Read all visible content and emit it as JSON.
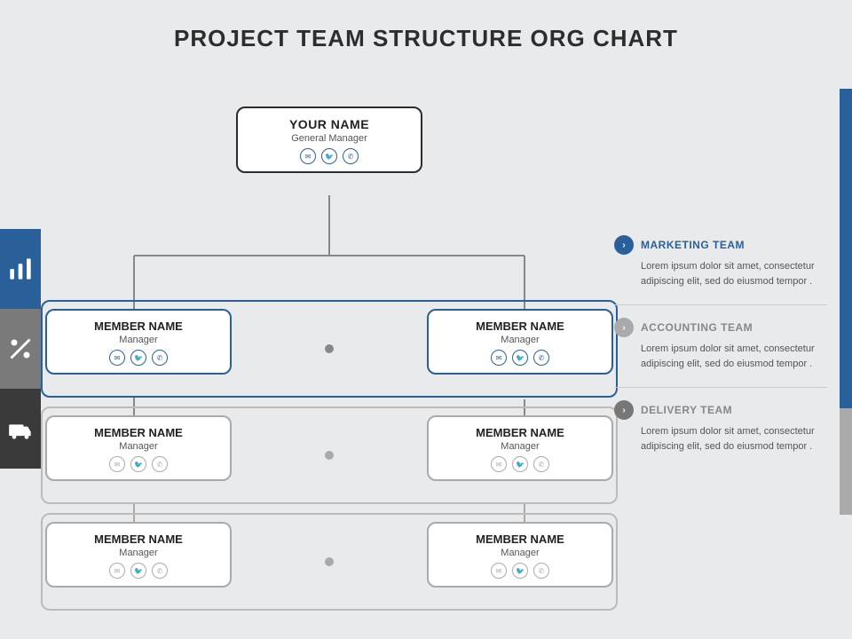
{
  "title": "PROJECT TEAM STRUCTURE ORG CHART",
  "top_node": {
    "name": "YOUR NAME",
    "role": "General Manager"
  },
  "sidebar": {
    "tabs": [
      {
        "icon": "chart-icon",
        "active": true
      },
      {
        "icon": "percent-icon",
        "active": false
      },
      {
        "icon": "truck-icon",
        "active": false
      }
    ]
  },
  "rows": [
    {
      "band_color": "blue",
      "left": {
        "name": "MEMBER NAME",
        "role": "Manager"
      },
      "right": {
        "name": "MEMBER NAME",
        "role": "Manager"
      }
    },
    {
      "band_color": "gray",
      "left": {
        "name": "MEMBER NAME",
        "role": "Manager"
      },
      "right": {
        "name": "MEMBER NAME",
        "role": "Manager"
      }
    },
    {
      "band_color": "gray",
      "left": {
        "name": "MEMBER NAME",
        "role": "Manager"
      },
      "right": {
        "name": "MEMBER NAME",
        "role": "Manager"
      }
    }
  ],
  "info_panel": [
    {
      "team": "MARKETING TEAM",
      "team_color": "blue",
      "chevron_color": "blue",
      "text": "Lorem ipsum dolor sit amet, consectetur adipiscing elit, sed do eiusmod tempor ."
    },
    {
      "team": "ACCOUNTING TEAM",
      "team_color": "gray",
      "chevron_color": "gray",
      "text": "Lorem ipsum dolor sit amet, consectetur adipiscing elit, sed do eiusmod tempor ."
    },
    {
      "team": "DELIVERY TEAM",
      "team_color": "gray",
      "chevron_color": "dark-gray",
      "text": "Lorem ipsum dolor sit amet, consectetur adipiscing elit, sed do eiusmod tempor ."
    }
  ]
}
